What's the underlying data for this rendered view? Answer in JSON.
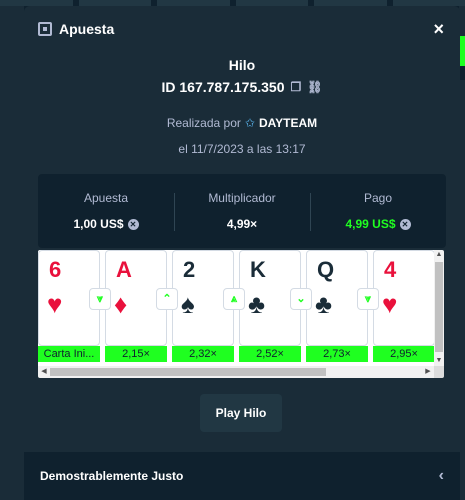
{
  "modal": {
    "title": "Apuesta",
    "close_glyph": "×",
    "game_name": "Hilo",
    "bet_id": "ID 167.787.175.350",
    "placed_by_prefix": "Realizada por",
    "user": "DAYTEAM",
    "date": "el 11/7/2023 a las 13:17"
  },
  "stats": {
    "bet_label": "Apuesta",
    "bet_value": "1,00 US$",
    "multiplier_label": "Multiplicador",
    "multiplier_value": "4,99×",
    "payout_label": "Pago",
    "payout_value": "4,99 US$",
    "payout_color": "#1fff20"
  },
  "cards": [
    {
      "rank": "6",
      "suit": "♥",
      "color": "red",
      "label": "Carta Ini..."
    },
    {
      "rank": "A",
      "suit": "♦",
      "color": "red",
      "label": "2,15×"
    },
    {
      "rank": "2",
      "suit": "♠",
      "color": "black",
      "label": "2,32×"
    },
    {
      "rank": "K",
      "suit": "♣",
      "color": "black",
      "label": "2,52×"
    },
    {
      "rank": "Q",
      "suit": "♣",
      "color": "black",
      "label": "2,73×"
    },
    {
      "rank": "4",
      "suit": "♥",
      "color": "red",
      "label": "2,95×"
    }
  ],
  "guesses": [
    "lower-icon",
    "higher-icon",
    "higher-or-equal-icon",
    "lower-icon",
    "lower-or-equal-icon"
  ],
  "guess_glyphs": [
    "⩔",
    "⌃",
    "⩓",
    "⌄",
    "⩔"
  ],
  "play_button": "Play Hilo",
  "footer": {
    "title": "Demostrablemente Justo",
    "chevron": "‹"
  },
  "colors": {
    "win_green": "#1fff20",
    "card_red": "#e9113c",
    "panel": "#1a2c38",
    "background": "#0f212e"
  }
}
